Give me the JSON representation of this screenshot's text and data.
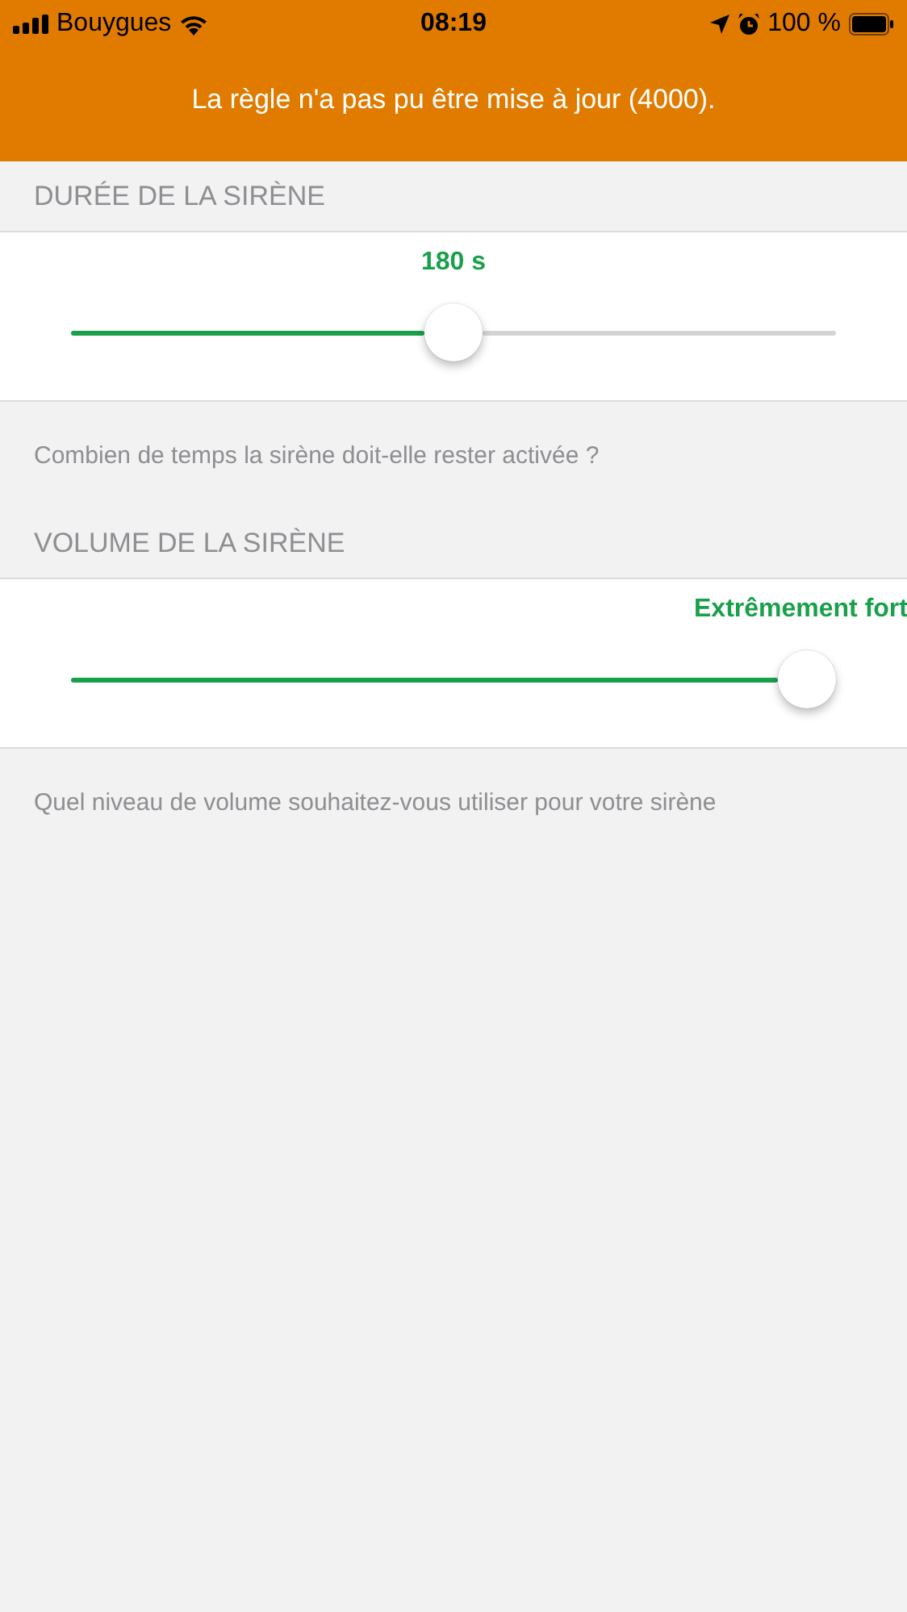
{
  "status_bar": {
    "carrier": "Bouygues",
    "time": "08:19",
    "battery": "100 %"
  },
  "banner": {
    "message": "La règle n'a pas pu être mise à jour (4000)."
  },
  "sections": [
    {
      "header": "DURÉE DE LA SIRÈNE",
      "value": "180 s",
      "level": 0.5,
      "footer": "Combien de temps la sirène doit-elle rester activée ?"
    },
    {
      "header": "VOLUME DE LA SIRÈNE",
      "value": "Extrêmement fort",
      "level": 1,
      "footer": "Quel niveau de volume souhaitez-vous utiliser pour votre sirène"
    }
  ]
}
